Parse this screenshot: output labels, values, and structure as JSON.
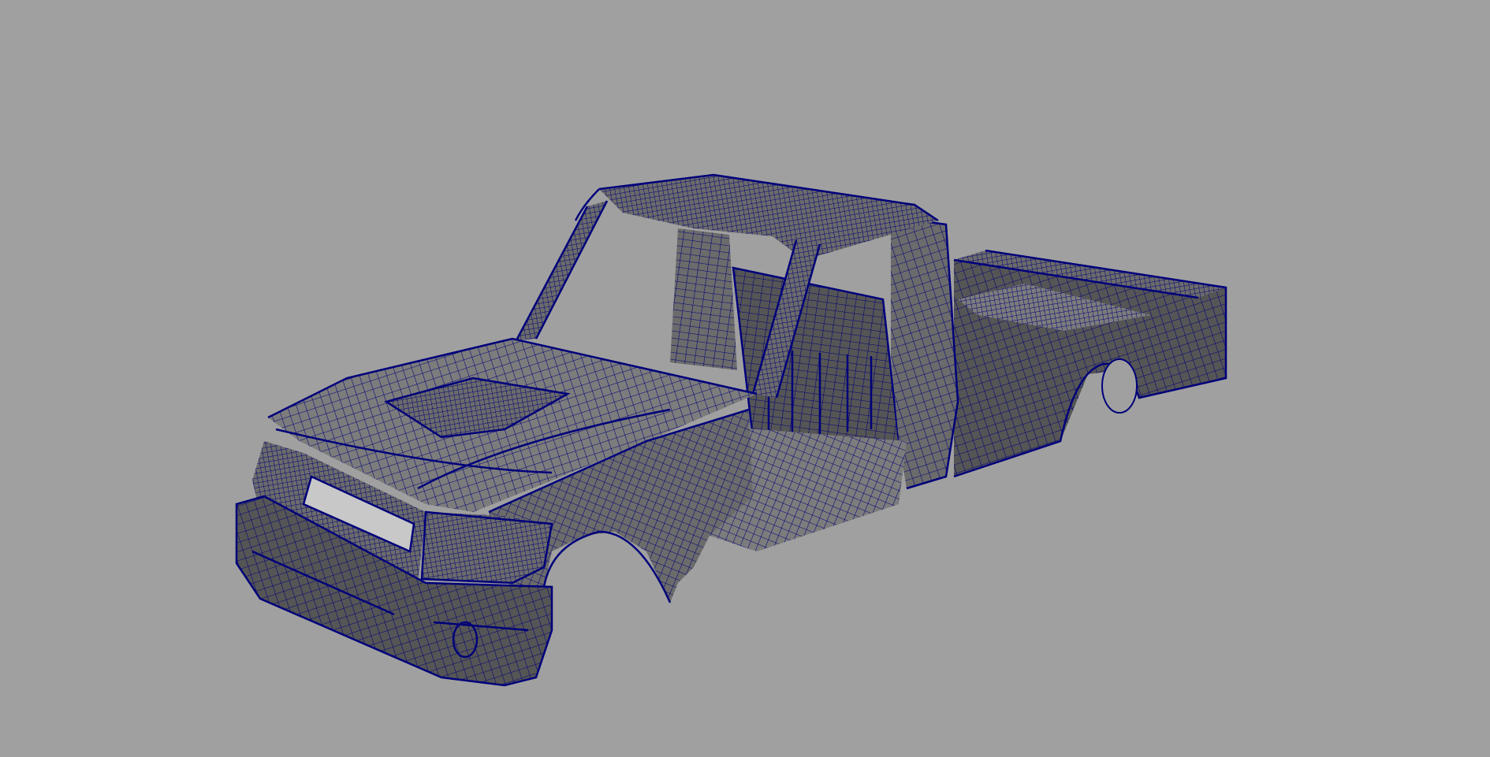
{
  "viewport": {
    "background_color": "#a0a0a0",
    "display_mode": "wireframe-on-shaded"
  },
  "model": {
    "object": "pickup-truck-body",
    "surface_color": "#6b6b6b",
    "surface_light_color": "#7c7c7c",
    "surface_dark_color": "#555555",
    "wire_color": "#00007a"
  }
}
